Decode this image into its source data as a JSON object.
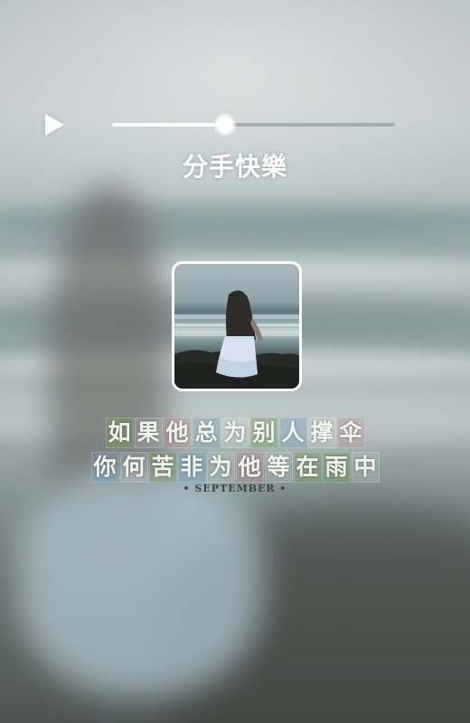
{
  "player": {
    "state": "paused",
    "play_icon": "play-icon",
    "progress": 0.4,
    "title": "分手快樂"
  },
  "lyrics": {
    "lines": [
      "如果他总为别人撑伞",
      "你何苦非为他等在雨中"
    ],
    "caption": "• SEPTEMBER •"
  },
  "colors": {
    "text": "#ffffff",
    "track": "#96a4a0",
    "caption": "#3e4542"
  }
}
